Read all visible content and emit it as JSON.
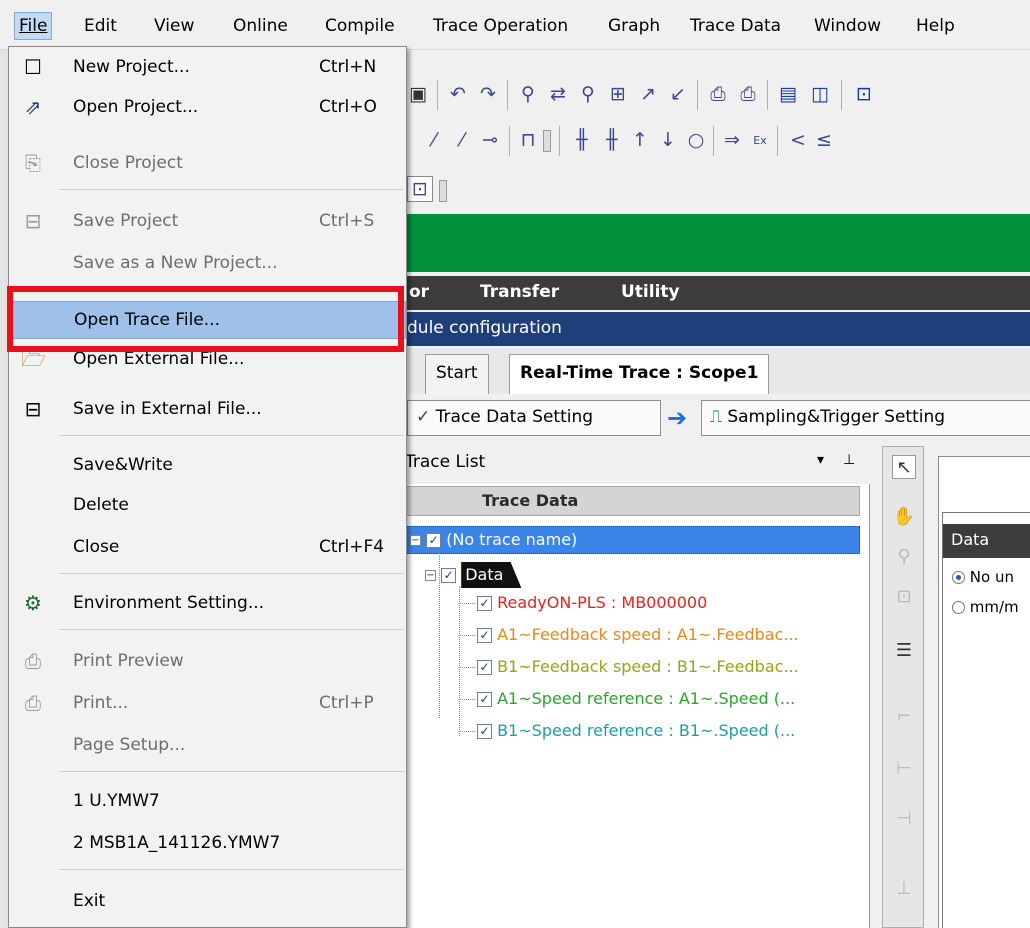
{
  "menubar": {
    "items": [
      "File",
      "Edit",
      "View",
      "Online",
      "Compile",
      "Trace Operation",
      "Graph",
      "Trace Data",
      "Window",
      "Help"
    ]
  },
  "file_menu": {
    "new_project": {
      "label": "New Project...",
      "shortcut": "Ctrl+N"
    },
    "open_project": {
      "label": "Open Project...",
      "shortcut": "Ctrl+O"
    },
    "close_project": {
      "label": "Close Project"
    },
    "save_project": {
      "label": "Save Project",
      "shortcut": "Ctrl+S"
    },
    "save_as_new": {
      "label": "Save as a New Project..."
    },
    "open_trace_file": {
      "label": "Open Trace File..."
    },
    "open_external": {
      "label": "Open External File..."
    },
    "save_external": {
      "label": "Save in External File..."
    },
    "save_write": {
      "label": "Save&Write"
    },
    "delete": {
      "label": "Delete"
    },
    "close": {
      "label": "Close",
      "shortcut": "Ctrl+F4"
    },
    "environment": {
      "label": "Environment Setting..."
    },
    "print_preview": {
      "label": "Print Preview"
    },
    "print": {
      "label": "Print...",
      "shortcut": "Ctrl+P"
    },
    "page_setup": {
      "label": "Page Setup..."
    },
    "recent1": {
      "label": "1 U.YMW7"
    },
    "recent2": {
      "label": "2 MSB1A_141126.YMW7"
    },
    "exit": {
      "label": "Exit"
    }
  },
  "background": {
    "darkmenu": {
      "item0": "or",
      "item1": "Transfer",
      "item2": "Utility"
    },
    "bluebar": "dule configuration",
    "tabs": {
      "start": "Start",
      "active": "Real-Time Trace : Scope1"
    },
    "settings": {
      "trace_data": "Trace Data Setting",
      "sampling": "Sampling&Trigger Setting"
    },
    "trace_list": {
      "title": "Trace List",
      "column": "Trace Data",
      "root": "(No trace name)",
      "group": "Data",
      "items": [
        {
          "text": "ReadyON-PLS : MB000000",
          "color": "#e8231f"
        },
        {
          "text": "A1~Feedback speed : A1~.Feedbac...",
          "color": "#e8891a"
        },
        {
          "text": "B1~Feedback speed : B1~.Feedbac...",
          "color": "#9aa318"
        },
        {
          "text": "A1~Speed reference : A1~.Speed (...",
          "color": "#2aa52a"
        },
        {
          "text": "B1~Speed reference : B1~.Speed (...",
          "color": "#1f9e9e"
        }
      ]
    },
    "graph": {
      "data_header": "Data",
      "radio1": "No un",
      "radio2": "mm/m"
    }
  },
  "colors": {
    "highlight_box": "#e8101a",
    "green_banner": "#00913a",
    "menu_highlight": "#9fc0e8"
  }
}
